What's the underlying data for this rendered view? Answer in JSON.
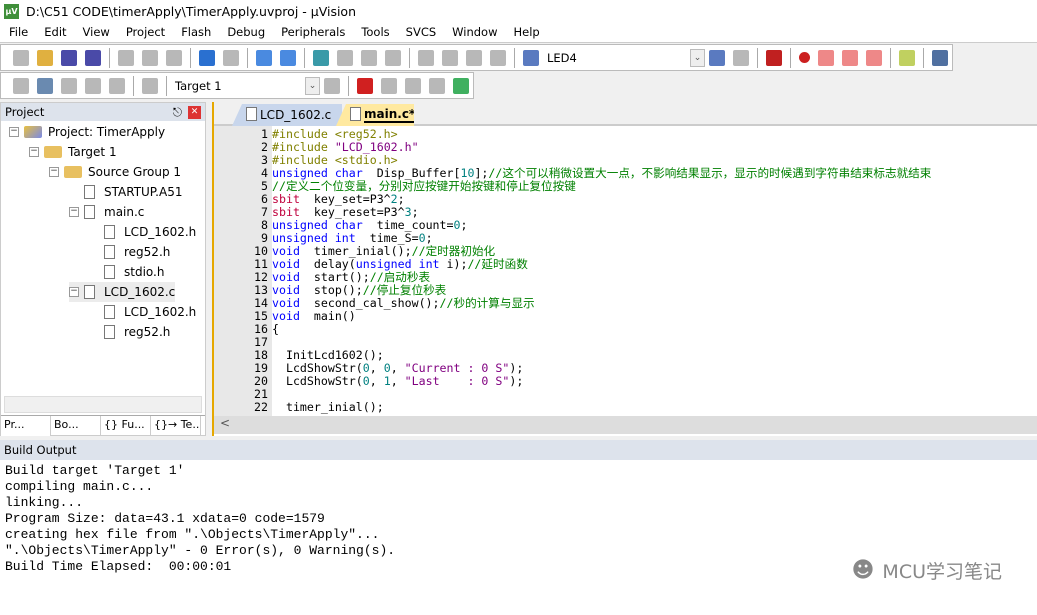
{
  "window": {
    "title": "D:\\C51 CODE\\timerApply\\TimerApply.uvproj - µVision",
    "app_icon": "µV"
  },
  "menu": [
    "File",
    "Edit",
    "View",
    "Project",
    "Flash",
    "Debug",
    "Peripherals",
    "Tools",
    "SVCS",
    "Window",
    "Help"
  ],
  "toolbar1": {
    "icons_left": [
      "new-file-icon",
      "open-folder-icon",
      "save-icon",
      "save-all-icon",
      "|",
      "cut-icon",
      "copy-icon",
      "paste-icon",
      "|",
      "undo-icon",
      "redo-icon",
      "|",
      "navigate-back-icon",
      "navigate-forward-icon",
      "|",
      "bookmark-icon",
      "prev-bookmark-icon",
      "next-bookmark-icon",
      "clear-bookmarks-icon",
      "|",
      "indent-icon",
      "unindent-icon",
      "comment-icon",
      "uncomment-icon",
      "|",
      "find-in-files-icon"
    ],
    "find_value": "LED4",
    "icons_right": [
      "find-icon",
      "incremental-find-icon",
      "|",
      "debug-session-icon",
      "|",
      "breakpoint-icon",
      "disable-breakpoint-icon",
      "disable-all-breakpoints-icon",
      "kill-all-breakpoints-icon",
      "|",
      "window-layout-icon",
      "|",
      "configure-icon"
    ]
  },
  "toolbar2": {
    "icons_left": [
      "translate-icon",
      "build-icon",
      "rebuild-icon",
      "batch-build-icon",
      "stop-build-icon",
      "|",
      "download-icon",
      "|"
    ],
    "target": "Target 1",
    "icons_right": [
      "target-options-icon",
      "|",
      "manage-components-icon",
      "select-packs-icon",
      "software-packs-icon",
      "pack-installer-icon",
      "run-time-env-icon"
    ]
  },
  "project": {
    "title": "Project",
    "tree": [
      {
        "label": "Project: TimerApply",
        "kind": "project",
        "level": 0,
        "expanded": true
      },
      {
        "label": "Target 1",
        "kind": "target",
        "level": 1,
        "expanded": true
      },
      {
        "label": "Source Group 1",
        "kind": "folder",
        "level": 2,
        "expanded": true
      },
      {
        "label": "STARTUP.A51",
        "kind": "file",
        "level": 3
      },
      {
        "label": "main.c",
        "kind": "file",
        "level": 3,
        "expanded": true
      },
      {
        "label": "LCD_1602.h",
        "kind": "header",
        "level": 4
      },
      {
        "label": "reg52.h",
        "kind": "header",
        "level": 4
      },
      {
        "label": "stdio.h",
        "kind": "header",
        "level": 4
      },
      {
        "label": "LCD_1602.c",
        "kind": "file",
        "level": 3,
        "expanded": true,
        "selected": true
      },
      {
        "label": "LCD_1602.h",
        "kind": "header",
        "level": 4
      },
      {
        "label": "reg52.h",
        "kind": "header",
        "level": 4
      }
    ],
    "tabs": [
      "Pr...",
      "Bo...",
      "{} Fu...",
      "{}→ Te..."
    ]
  },
  "editor": {
    "tabs": [
      {
        "label": "LCD_1602.c",
        "active": false
      },
      {
        "label": "main.c*",
        "active": true
      }
    ],
    "lines": [
      [
        [
          "pp",
          "#include <reg52.h>"
        ]
      ],
      [
        [
          "pp",
          "#include "
        ],
        [
          "str",
          "\"LCD_1602.h\""
        ]
      ],
      [
        [
          "pp",
          "#include <stdio.h>"
        ]
      ],
      [
        [
          "kw",
          "unsigned char"
        ],
        [
          "",
          "  Disp_Buffer["
        ],
        [
          "num",
          "10"
        ],
        [
          "",
          "];"
        ],
        [
          "cm",
          "//这个可以稍微设置大一点，不影响结果显示，显示的时候遇到字符串结束标志就结束"
        ]
      ],
      [
        [
          "cm",
          "//定义二个位变量，分别对应按键开始按键和停止复位按键"
        ]
      ],
      [
        [
          "sb",
          "sbit"
        ],
        [
          "",
          "  key_set=P3^"
        ],
        [
          "num",
          "2"
        ],
        [
          "",
          ";"
        ]
      ],
      [
        [
          "sb",
          "sbit"
        ],
        [
          "",
          "  key_reset=P3^"
        ],
        [
          "num",
          "3"
        ],
        [
          "",
          ";"
        ]
      ],
      [
        [
          "kw",
          "unsigned char"
        ],
        [
          "",
          "  time_count="
        ],
        [
          "num",
          "0"
        ],
        [
          "",
          ";"
        ]
      ],
      [
        [
          "kw",
          "unsigned int"
        ],
        [
          "",
          "  time_S="
        ],
        [
          "num",
          "0"
        ],
        [
          "",
          ";"
        ]
      ],
      [
        [
          "kw",
          "void"
        ],
        [
          "",
          "  timer_inial();"
        ],
        [
          "cm",
          "//定时器初始化"
        ]
      ],
      [
        [
          "kw",
          "void"
        ],
        [
          "",
          "  delay("
        ],
        [
          "kw",
          "unsigned int"
        ],
        [
          "",
          " i);"
        ],
        [
          "cm",
          "//延时函数"
        ]
      ],
      [
        [
          "kw",
          "void"
        ],
        [
          "",
          "  start();"
        ],
        [
          "cm",
          "//启动秒表"
        ]
      ],
      [
        [
          "kw",
          "void"
        ],
        [
          "",
          "  stop();"
        ],
        [
          "cm",
          "//停止复位秒表"
        ]
      ],
      [
        [
          "kw",
          "void"
        ],
        [
          "",
          "  second_cal_show();"
        ],
        [
          "cm",
          "//秒的计算与显示"
        ]
      ],
      [
        [
          "kw",
          "void"
        ],
        [
          "",
          "  main()"
        ]
      ],
      [
        [
          "",
          "{"
        ]
      ],
      [
        [
          "",
          ""
        ]
      ],
      [
        [
          "",
          "  InitLcd1602();"
        ]
      ],
      [
        [
          "",
          "  LcdShowStr("
        ],
        [
          "num",
          "0"
        ],
        [
          "",
          ", "
        ],
        [
          "num",
          "0"
        ],
        [
          "",
          ", "
        ],
        [
          "str",
          "\"Current : 0 S\""
        ],
        [
          "",
          ");"
        ]
      ],
      [
        [
          "",
          "  LcdShowStr("
        ],
        [
          "num",
          "0"
        ],
        [
          "",
          ", "
        ],
        [
          "num",
          "1"
        ],
        [
          "",
          ", "
        ],
        [
          "str",
          "\"Last    : 0 S\""
        ],
        [
          "",
          ");"
        ]
      ],
      [
        [
          "",
          ""
        ]
      ],
      [
        [
          "",
          "  timer_inial();"
        ]
      ]
    ]
  },
  "build_output": {
    "title": "Build Output",
    "lines": [
      "Build target 'Target 1'",
      "compiling main.c...",
      "linking...",
      "Program Size: data=43.1 xdata=0 code=1579",
      "creating hex file from \".\\Objects\\TimerApply\"...",
      "\".\\Objects\\TimerApply\" - 0 Error(s), 0 Warning(s).",
      "Build Time Elapsed:  00:00:01"
    ]
  },
  "watermark": "MCU学习笔记",
  "colors": {
    "keyword": "#0000ff",
    "preprocessor": "#808000",
    "string": "#800080",
    "number": "#008080",
    "comment": "#008000",
    "sbit": "#c0003c",
    "active_tab": "#ffe9a0",
    "panel_header": "#dde3ec"
  }
}
